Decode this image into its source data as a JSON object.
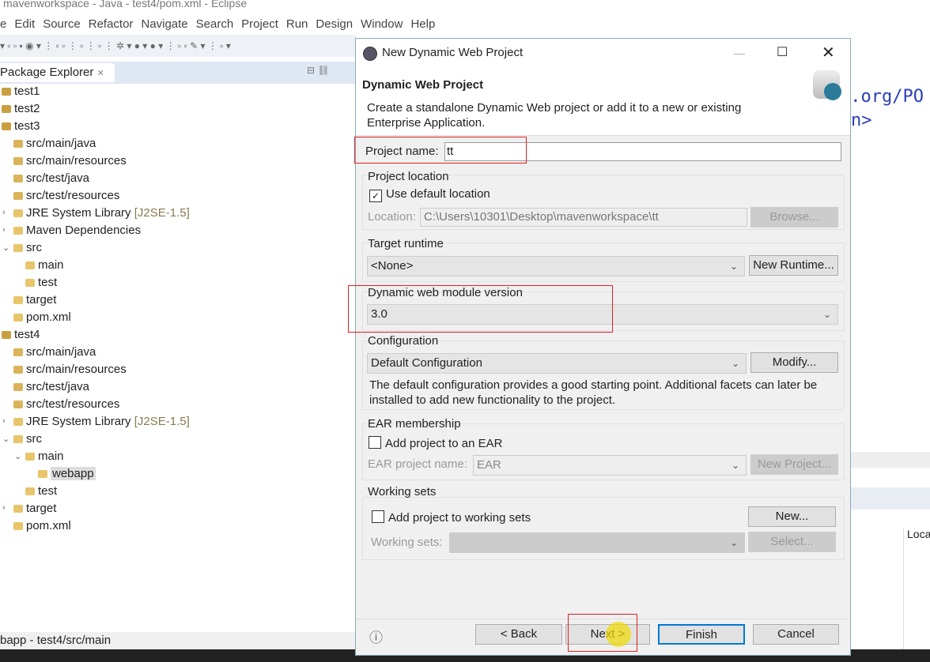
{
  "window": {
    "title": "mavenworkspace - Java - test4/pom.xml - Eclipse"
  },
  "menu": [
    "e",
    "Edit",
    "Source",
    "Refactor",
    "Navigate",
    "Search",
    "Project",
    "Run",
    "Design",
    "Window",
    "Help"
  ],
  "package_explorer": {
    "title": "Package Explorer",
    "items": [
      {
        "label": "test1",
        "level": 0
      },
      {
        "label": "test2",
        "level": 0
      },
      {
        "label": "test3",
        "level": 0
      },
      {
        "label": "src/main/java",
        "level": 1
      },
      {
        "label": "src/main/resources",
        "level": 1
      },
      {
        "label": "src/test/java",
        "level": 1
      },
      {
        "label": "src/test/resources",
        "level": 1
      },
      {
        "label": "JRE System Library",
        "suffix": "[J2SE-1.5]",
        "level": 1,
        "chevron": "›"
      },
      {
        "label": "Maven Dependencies",
        "level": 1,
        "chevron": "›"
      },
      {
        "label": "src",
        "level": 1,
        "chevron": "⌄"
      },
      {
        "label": "main",
        "level": 2
      },
      {
        "label": "test",
        "level": 2
      },
      {
        "label": "target",
        "level": 1
      },
      {
        "label": "pom.xml",
        "level": 1
      },
      {
        "label": "test4",
        "level": 0
      },
      {
        "label": "src/main/java",
        "level": 1
      },
      {
        "label": "src/main/resources",
        "level": 1
      },
      {
        "label": "src/test/java",
        "level": 1
      },
      {
        "label": "src/test/resources",
        "level": 1
      },
      {
        "label": "JRE System Library",
        "suffix": "[J2SE-1.5]",
        "level": 1,
        "chevron": "›"
      },
      {
        "label": "src",
        "level": 1,
        "chevron": "⌄"
      },
      {
        "label": "main",
        "level": 2,
        "chevron": "⌄"
      },
      {
        "label": "webapp",
        "level": 3,
        "selected": true
      },
      {
        "label": "test",
        "level": 2
      },
      {
        "label": "target",
        "level": 1,
        "chevron": "›"
      },
      {
        "label": "pom.xml",
        "level": 1
      }
    ]
  },
  "status_bar": {
    "text": "bapp - test4/src/main"
  },
  "editor": {
    "line1": "e.org/PO",
    "line2": "n>",
    "table_header": "Loca"
  },
  "dialog": {
    "title": "New Dynamic Web Project",
    "heading": "Dynamic Web Project",
    "description": "Create a standalone Dynamic Web project or add it to a new or existing Enterprise Application.",
    "project_name_label": "Project name:",
    "project_name_value": "tt",
    "location_group": "Project location",
    "use_default_label": "Use default location",
    "use_default_checked": true,
    "location_label": "Location:",
    "location_value": "C:\\Users\\10301\\Desktop\\mavenworkspace\\tt",
    "browse": "Browse...",
    "runtime_group": "Target runtime",
    "runtime_value": "<None>",
    "new_runtime": "New Runtime...",
    "module_group": "Dynamic web module version",
    "module_value": "3.0",
    "config_group": "Configuration",
    "config_value": "Default Configuration",
    "modify": "Modify...",
    "config_desc": "The default configuration provides a good starting point. Additional facets can later be installed to add new functionality to the project.",
    "ear_group": "EAR membership",
    "ear_checkbox": "Add project to an EAR",
    "ear_name_label": "EAR project name:",
    "ear_name_value": "EAR",
    "new_project": "New Project...",
    "ws_group": "Working sets",
    "ws_checkbox": "Add project to working sets",
    "ws_new": "New...",
    "ws_label": "Working sets:",
    "ws_select": "Select...",
    "back": "< Back",
    "next": "Next >",
    "finish": "Finish",
    "cancel": "Cancel"
  }
}
